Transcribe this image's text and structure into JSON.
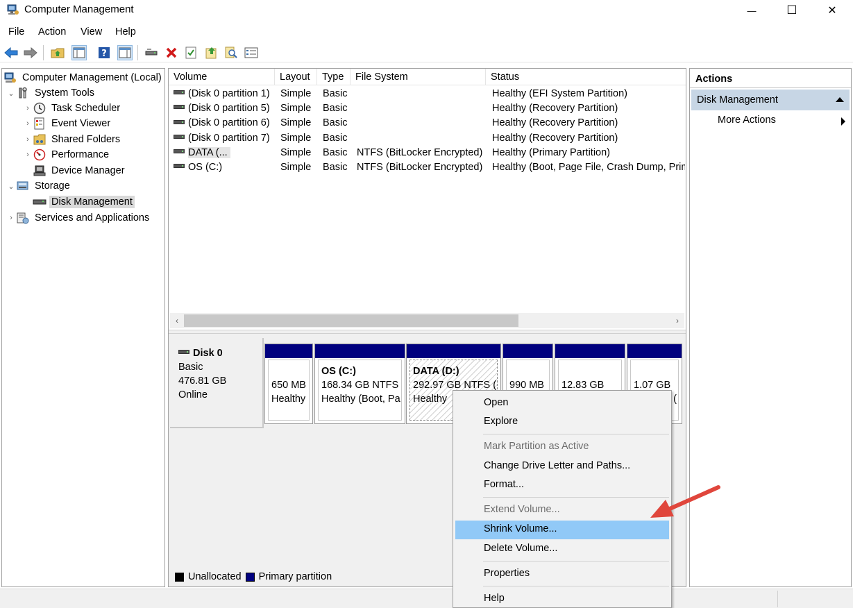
{
  "window": {
    "title": "Computer Management",
    "min_glyph": "—",
    "max_glyph": "☐",
    "close_glyph": "✕"
  },
  "menubar": [
    "File",
    "Action",
    "View",
    "Help"
  ],
  "toolbar_icons": [
    "back-icon",
    "forward-icon",
    "up-folder-icon",
    "show-hide-tree-icon",
    "help-icon",
    "show-hide-action-pane-icon",
    "connect-icon",
    "delete-icon",
    "properties-icon",
    "export-icon",
    "search-icon",
    "list-icon"
  ],
  "tree": {
    "root": "Computer Management (Local)",
    "system_tools": "System Tools",
    "task_scheduler": "Task Scheduler",
    "event_viewer": "Event Viewer",
    "shared_folders": "Shared Folders",
    "performance": "Performance",
    "device_manager": "Device Manager",
    "storage": "Storage",
    "disk_management": "Disk Management",
    "services_apps": "Services and Applications"
  },
  "volume_table": {
    "columns": [
      "Volume",
      "Layout",
      "Type",
      "File System",
      "Status"
    ],
    "rows": [
      {
        "volume": "(Disk 0 partition 1)",
        "layout": "Simple",
        "type": "Basic",
        "fs": "",
        "status": "Healthy (EFI System Partition)"
      },
      {
        "volume": "(Disk 0 partition 5)",
        "layout": "Simple",
        "type": "Basic",
        "fs": "",
        "status": "Healthy (Recovery Partition)"
      },
      {
        "volume": "(Disk 0 partition 6)",
        "layout": "Simple",
        "type": "Basic",
        "fs": "",
        "status": "Healthy (Recovery Partition)"
      },
      {
        "volume": "(Disk 0 partition 7)",
        "layout": "Simple",
        "type": "Basic",
        "fs": "",
        "status": "Healthy (Recovery Partition)"
      },
      {
        "volume": "DATA (...",
        "layout": "Simple",
        "type": "Basic",
        "fs": "NTFS (BitLocker Encrypted)",
        "status": "Healthy (Primary Partition)"
      },
      {
        "volume": "OS (C:)",
        "layout": "Simple",
        "type": "Basic",
        "fs": "NTFS (BitLocker Encrypted)",
        "status": "Healthy (Boot, Page File, Crash Dump, Primary Partition)"
      }
    ]
  },
  "scroll": {
    "left": "‹",
    "right": "›"
  },
  "disk": {
    "name": "Disk 0",
    "type": "Basic",
    "size": "476.81 GB",
    "state": "Online",
    "partitions": [
      {
        "title": "",
        "size": "650 MB",
        "status": "Healthy"
      },
      {
        "title": "OS  (C:)",
        "size": "168.34 GB NTFS (",
        "status": "Healthy (Boot, Pa"
      },
      {
        "title": "DATA  (D:)",
        "size": "292.97 GB NTFS (E",
        "status": "Healthy"
      },
      {
        "title": "",
        "size": "990 MB",
        "status": ""
      },
      {
        "title": "",
        "size": "12.83 GB",
        "status": ""
      },
      {
        "title": "",
        "size": "1.07 GB",
        "status": "("
      }
    ]
  },
  "legend": {
    "unallocated": "Unallocated",
    "primary": "Primary partition",
    "unallocated_color": "#000000",
    "primary_color": "#00007f"
  },
  "actions": {
    "title": "Actions",
    "group": "Disk Management",
    "more": "More Actions"
  },
  "context_menu": {
    "open": "Open",
    "explore": "Explore",
    "mark_active": "Mark Partition as Active",
    "change_letter": "Change Drive Letter and Paths...",
    "format": "Format...",
    "extend": "Extend Volume...",
    "shrink": "Shrink Volume...",
    "delete": "Delete Volume...",
    "properties": "Properties",
    "help": "Help"
  },
  "colors": {
    "partition_bar": "#00007f",
    "highlight": "#91c9f7",
    "action_group": "#c7d6e5",
    "annotation_arrow": "#e0463c"
  }
}
